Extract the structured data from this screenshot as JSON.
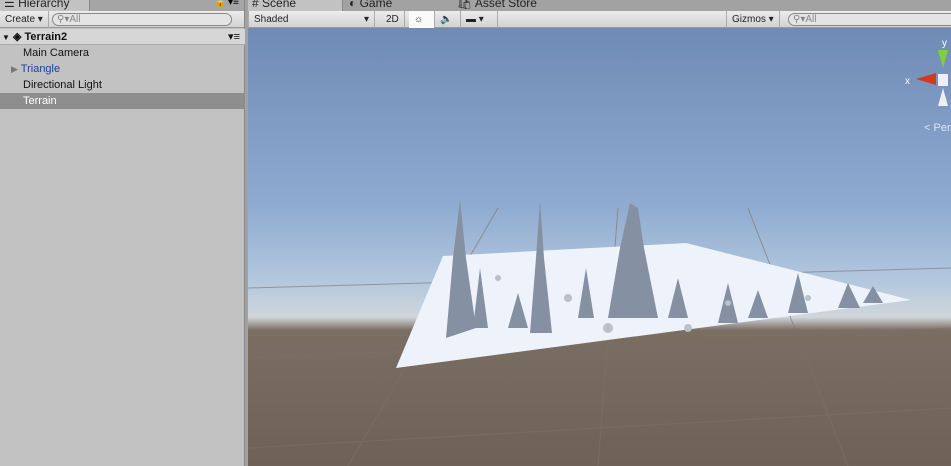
{
  "hierarchy": {
    "tab": "Hierarchy",
    "create": "Create",
    "search_placeholder": "All",
    "scene_root": "Terrain2",
    "items": [
      {
        "label": "Main Camera"
      },
      {
        "label": "Triangle"
      },
      {
        "label": "Directional Light"
      },
      {
        "label": "Terrain"
      }
    ]
  },
  "tabs": {
    "scene": "Scene",
    "game": "Game",
    "asset_store": "Asset Store"
  },
  "scene_toolbar": {
    "shading": "Shaded",
    "mode_2d": "2D",
    "gizmos": "Gizmos",
    "search_placeholder": "All"
  },
  "gizmo": {
    "y": "y",
    "x": "x",
    "persp": "Persp"
  }
}
